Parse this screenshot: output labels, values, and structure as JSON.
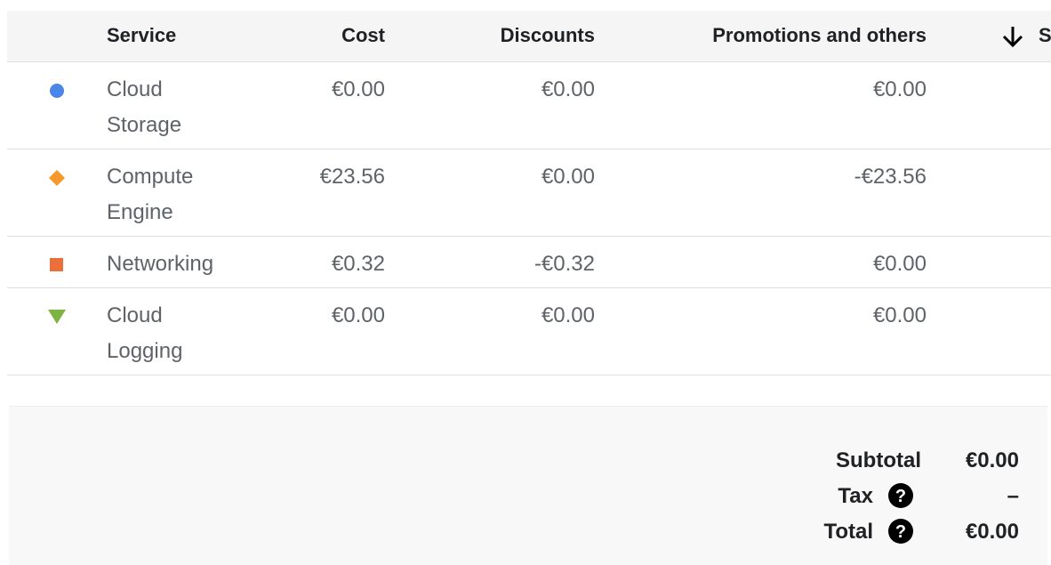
{
  "table": {
    "headers": {
      "service": "Service",
      "cost": "Cost",
      "discounts": "Discounts",
      "promotions": "Promotions and others",
      "clipped": "S"
    },
    "sort_icon": "arrow-down-icon",
    "rows": [
      {
        "service": "Cloud Storage",
        "cost": "€0.00",
        "discounts": "€0.00",
        "promotions": "€0.00",
        "marker": "circle",
        "color": "#4a86e8"
      },
      {
        "service": "Compute Engine",
        "cost": "€23.56",
        "discounts": "€0.00",
        "promotions": "-€23.56",
        "marker": "diamond",
        "color": "#f6992d"
      },
      {
        "service": "Networking",
        "cost": "€0.32",
        "discounts": "-€0.32",
        "promotions": "€0.00",
        "marker": "square",
        "color": "#ec6e3a"
      },
      {
        "service": "Cloud Logging",
        "cost": "€0.00",
        "discounts": "€0.00",
        "promotions": "€0.00",
        "marker": "triangle-down",
        "color": "#7cb342"
      }
    ]
  },
  "summary": {
    "subtotal_label": "Subtotal",
    "subtotal_value": "€0.00",
    "tax_label": "Tax",
    "tax_value": "–",
    "total_label": "Total",
    "total_value": "€0.00",
    "help_icon": "help-circle-icon"
  }
}
